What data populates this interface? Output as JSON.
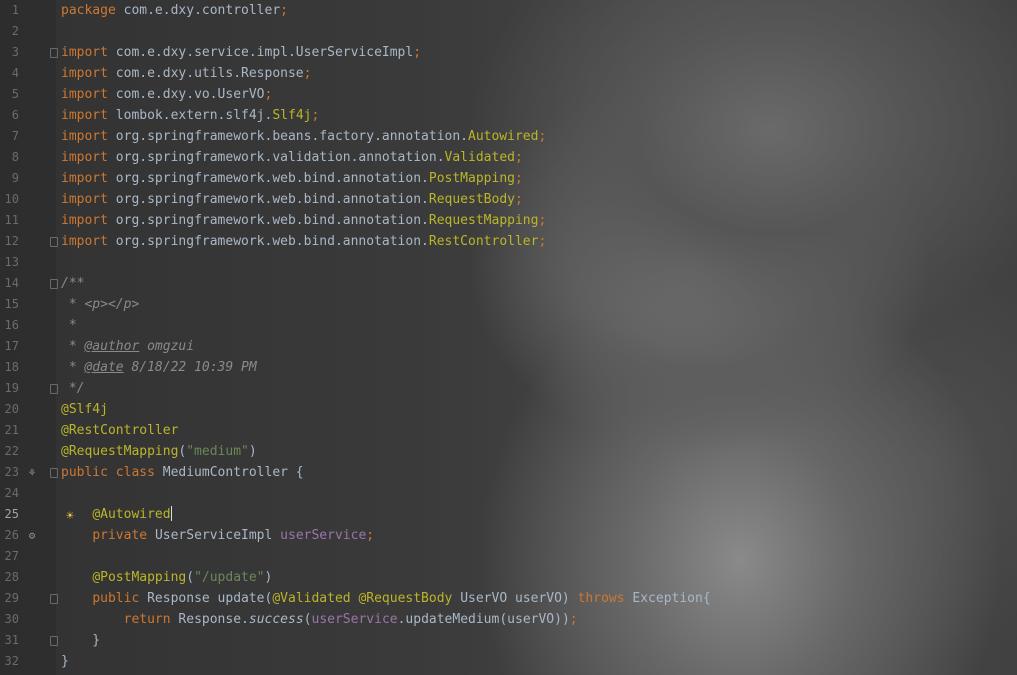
{
  "editor": {
    "current_line": 25,
    "lines": [
      {
        "n": "1",
        "parts": [
          [
            "kw",
            "package "
          ],
          [
            "",
            "com.e.dxy.controller"
          ],
          [
            "kw",
            ";"
          ]
        ]
      },
      {
        "n": "2",
        "parts": []
      },
      {
        "n": "3",
        "fold": true,
        "parts": [
          [
            "kw",
            "import "
          ],
          [
            "",
            "com.e.dxy.service.impl.UserServiceImpl"
          ],
          [
            "kw",
            ";"
          ]
        ]
      },
      {
        "n": "4",
        "parts": [
          [
            "kw",
            "import "
          ],
          [
            "",
            "com.e.dxy.utils.Response"
          ],
          [
            "kw",
            ";"
          ]
        ]
      },
      {
        "n": "5",
        "parts": [
          [
            "kw",
            "import "
          ],
          [
            "",
            "com.e.dxy.vo.UserVO"
          ],
          [
            "kw",
            ";"
          ]
        ]
      },
      {
        "n": "6",
        "parts": [
          [
            "kw",
            "import "
          ],
          [
            "",
            "lombok.extern.slf4j."
          ],
          [
            "ann",
            "Slf4j"
          ],
          [
            "kw",
            ";"
          ]
        ]
      },
      {
        "n": "7",
        "parts": [
          [
            "kw",
            "import "
          ],
          [
            "",
            "org.springframework.beans.factory.annotation."
          ],
          [
            "ann",
            "Autowired"
          ],
          [
            "kw",
            ";"
          ]
        ]
      },
      {
        "n": "8",
        "parts": [
          [
            "kw",
            "import "
          ],
          [
            "",
            "org.springframework.validation.annotation."
          ],
          [
            "ann",
            "Validated"
          ],
          [
            "kw",
            ";"
          ]
        ]
      },
      {
        "n": "9",
        "parts": [
          [
            "kw",
            "import "
          ],
          [
            "",
            "org.springframework.web.bind.annotation."
          ],
          [
            "ann",
            "PostMapping"
          ],
          [
            "kw",
            ";"
          ]
        ]
      },
      {
        "n": "10",
        "parts": [
          [
            "kw",
            "import "
          ],
          [
            "",
            "org.springframework.web.bind.annotation."
          ],
          [
            "ann",
            "RequestBody"
          ],
          [
            "kw",
            ";"
          ]
        ]
      },
      {
        "n": "11",
        "parts": [
          [
            "kw",
            "import "
          ],
          [
            "",
            "org.springframework.web.bind.annotation."
          ],
          [
            "ann",
            "RequestMapping"
          ],
          [
            "kw",
            ";"
          ]
        ]
      },
      {
        "n": "12",
        "fold": true,
        "parts": [
          [
            "kw",
            "import "
          ],
          [
            "",
            "org.springframework.web.bind.annotation."
          ],
          [
            "ann",
            "RestController"
          ],
          [
            "kw",
            ";"
          ]
        ]
      },
      {
        "n": "13",
        "parts": []
      },
      {
        "n": "14",
        "fold": true,
        "parts": [
          [
            "cmt",
            "/**"
          ]
        ]
      },
      {
        "n": "15",
        "parts": [
          [
            "cmt",
            " * <p></p>"
          ]
        ]
      },
      {
        "n": "16",
        "parts": [
          [
            "cmt",
            " *"
          ]
        ]
      },
      {
        "n": "17",
        "parts": [
          [
            "cmt",
            " * "
          ],
          [
            "tag",
            "@author"
          ],
          [
            "cmt",
            " omgzui"
          ]
        ]
      },
      {
        "n": "18",
        "parts": [
          [
            "cmt",
            " * "
          ],
          [
            "tag",
            "@date"
          ],
          [
            "cmt",
            " 8/18/22 10:39 PM"
          ]
        ]
      },
      {
        "n": "19",
        "fold": true,
        "parts": [
          [
            "cmt",
            " */"
          ]
        ]
      },
      {
        "n": "20",
        "parts": [
          [
            "ann",
            "@Slf4j"
          ]
        ]
      },
      {
        "n": "21",
        "parts": [
          [
            "ann",
            "@RestController"
          ]
        ]
      },
      {
        "n": "22",
        "parts": [
          [
            "ann",
            "@RequestMapping"
          ],
          [
            "",
            "("
          ],
          [
            "str",
            "\"medium\""
          ],
          [
            "",
            ")"
          ]
        ]
      },
      {
        "n": "23",
        "gutter_icon": "bean-icon",
        "fold": true,
        "parts": [
          [
            "kw",
            "public class "
          ],
          [
            "",
            "MediumController {"
          ]
        ]
      },
      {
        "n": "24",
        "parts": []
      },
      {
        "n": "25",
        "bulb": true,
        "caret_after": 1,
        "parts": [
          [
            "",
            "    "
          ],
          [
            "ann",
            "@Autowired"
          ]
        ]
      },
      {
        "n": "26",
        "gutter_icon": "autowire-icon",
        "parts": [
          [
            "",
            "    "
          ],
          [
            "kw",
            "private "
          ],
          [
            "",
            "UserServiceImpl "
          ],
          [
            "field",
            "userService"
          ],
          [
            "kw",
            ";"
          ]
        ]
      },
      {
        "n": "27",
        "parts": []
      },
      {
        "n": "28",
        "parts": [
          [
            "",
            "    "
          ],
          [
            "ann",
            "@PostMapping"
          ],
          [
            "",
            "("
          ],
          [
            "str",
            "\"/update\""
          ],
          [
            "",
            ")"
          ]
        ]
      },
      {
        "n": "29",
        "fold": true,
        "parts": [
          [
            "",
            "    "
          ],
          [
            "kw",
            "public "
          ],
          [
            "",
            "Response update("
          ],
          [
            "ann",
            "@Validated "
          ],
          [
            "ann",
            "@RequestBody "
          ],
          [
            "",
            "UserVO userVO) "
          ],
          [
            "kw",
            "throws "
          ],
          [
            "",
            "Exception{"
          ]
        ]
      },
      {
        "n": "30",
        "parts": [
          [
            "",
            "        "
          ],
          [
            "kw",
            "return "
          ],
          [
            "",
            "Response."
          ],
          [
            "ital",
            "success"
          ],
          [
            "",
            "("
          ],
          [
            "field",
            "userService"
          ],
          [
            "",
            ".updateMedium(userVO))"
          ],
          [
            "kw",
            ";"
          ]
        ]
      },
      {
        "n": "31",
        "fold": true,
        "parts": [
          [
            "",
            "    }"
          ]
        ]
      },
      {
        "n": "32",
        "parts": [
          [
            "",
            "}"
          ]
        ]
      }
    ]
  },
  "icons": {
    "bulb": "lightbulb-icon",
    "bean": "bean-icon",
    "autowire": "autowire-icon",
    "fold": "fold-marker-icon"
  },
  "colors": {
    "keyword": "#cc7832",
    "annotation": "#bbb529",
    "comment": "#8a8a8a",
    "string": "#6a8759",
    "default": "#a9b7c6",
    "field": "#9876aa"
  }
}
